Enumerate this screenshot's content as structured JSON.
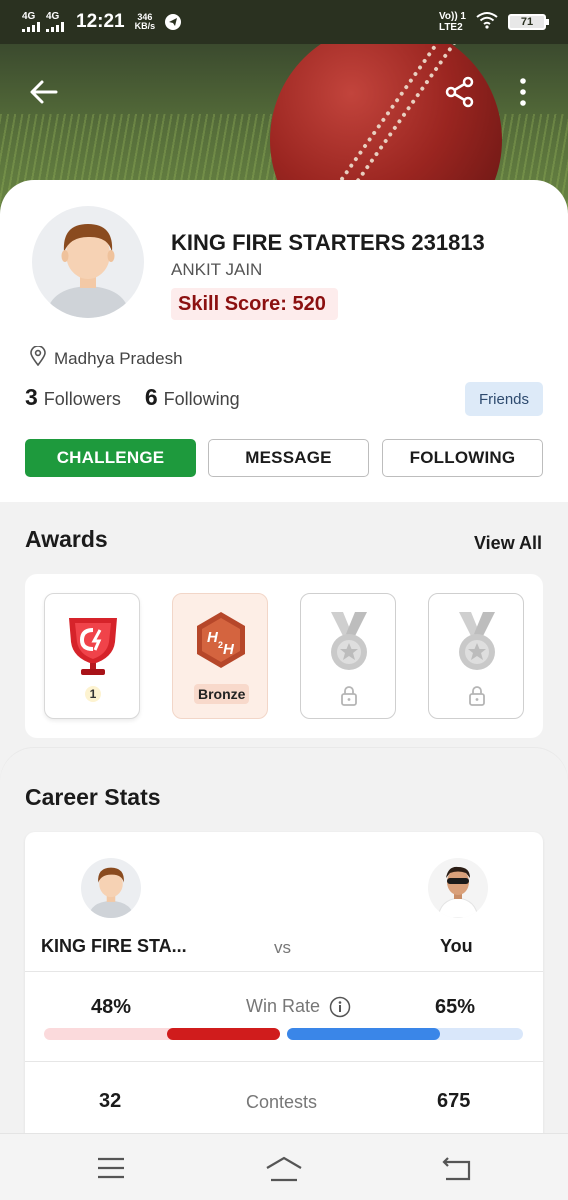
{
  "status_bar": {
    "network_1": "4G",
    "network_2": "4G",
    "time": "12:21",
    "speed_value": "346",
    "speed_unit": "KB/s",
    "volte_line1": "Vo)) 1",
    "volte_line2": "LTE2",
    "battery": "71"
  },
  "header": {
    "icons": [
      "back-arrow-icon",
      "share-icon",
      "more-vert-icon"
    ]
  },
  "profile": {
    "team_name": "KING FIRE STARTERS 231813",
    "user_name": "ANKIT JAIN",
    "skill_score": "Skill Score: 520",
    "location": "Madhya Pradesh",
    "followers_count": "3",
    "followers_label": "Followers",
    "following_count": "6",
    "following_label": "Following",
    "relationship_badge": "Friends",
    "buttons": {
      "challenge": "CHALLENGE",
      "message": "MESSAGE",
      "following": "FOLLOWING"
    }
  },
  "awards": {
    "title": "Awards",
    "view_all": "View All",
    "items": [
      {
        "icon": "contest-trophy-icon",
        "count": "1",
        "locked": false
      },
      {
        "icon": "h2h-badge-icon",
        "tier": "Bronze",
        "locked": false
      },
      {
        "icon": "medal-icon",
        "locked": true
      },
      {
        "icon": "medal-icon",
        "locked": true
      }
    ]
  },
  "career_stats": {
    "title": "Career Stats",
    "left_name": "KING FIRE STA...",
    "vs": "vs",
    "right_name": "You",
    "rows": [
      {
        "label": "Win Rate",
        "left": "48%",
        "right": "65%",
        "left_fraction": 0.48,
        "right_fraction": 0.65
      },
      {
        "label": "Contests",
        "left": "32",
        "right": "675"
      }
    ]
  },
  "colors": {
    "challenge_green": "#1e9a3d",
    "skill_red": "#8b1010",
    "left_bar_red": "#d01c1c",
    "right_bar_blue": "#3a86e8"
  },
  "nav_bar": {
    "icons": [
      "menu-icon",
      "home-icon",
      "back-icon"
    ]
  }
}
